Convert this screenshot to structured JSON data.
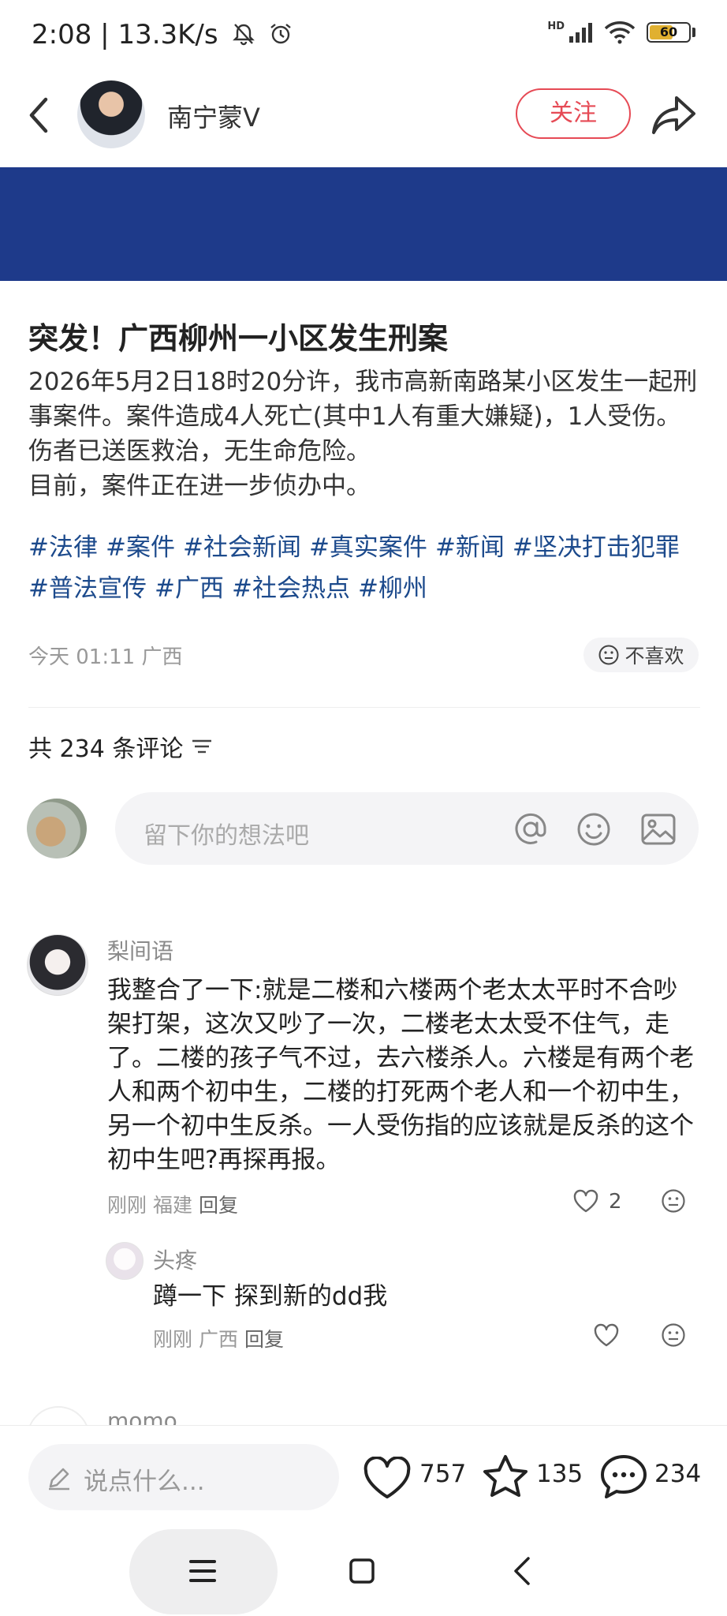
{
  "status_bar": {
    "time": "2:08",
    "speed": "13.3K/s",
    "network": "HD",
    "battery": "60",
    "battery_level": 0.6
  },
  "header": {
    "author": "南宁蒙V",
    "follow_label": "关注"
  },
  "article": {
    "title": "突发！广西柳州一小区发生刑案",
    "paragraphs": [
      "2026年5月2日18时20分许，我市高新南路某小区发生一起刑事案件。案件造成4人死亡(其中1人有重大嫌疑)，1人受伤。伤者已送医救治，无生命危险。",
      "目前，案件正在进一步侦办中。"
    ],
    "tags": [
      "#法律",
      "#案件",
      "#社会新闻",
      "#真实案件",
      "#新闻",
      "#坚决打击犯罪",
      "#普法宣传",
      "#广西",
      "#社会热点",
      "#柳州"
    ],
    "time": "今天 01:11 广西",
    "dislike_label": "不喜欢"
  },
  "comments_section": {
    "count_label": "共 234 条评论",
    "input_placeholder": "留下你的想法吧"
  },
  "comments": [
    {
      "name": "梨间语",
      "text": "我整合了一下:就是二楼和六楼两个老太太平时不合吵架打架，这次又吵了一次，二楼老太太受不住气，走了。二楼的孩子气不过，去六楼杀人。六楼是有两个老人和两个初中生，二楼的打死两个老人和一个初中生，另一个初中生反杀。一人受伤指的应该就是反杀的这个初中生吧?再探再报。",
      "time": "刚刚",
      "location": "福建",
      "reply_label": "回复",
      "likes": "2"
    },
    {
      "name": "头疼",
      "text": "蹲一下 探到新的dd我",
      "time": "刚刚",
      "location": "广西",
      "reply_label": "回复"
    },
    {
      "name": "momo"
    }
  ],
  "bottom_bar": {
    "say_placeholder": "说点什么...",
    "likes": "757",
    "stars": "135",
    "comments": "234"
  }
}
